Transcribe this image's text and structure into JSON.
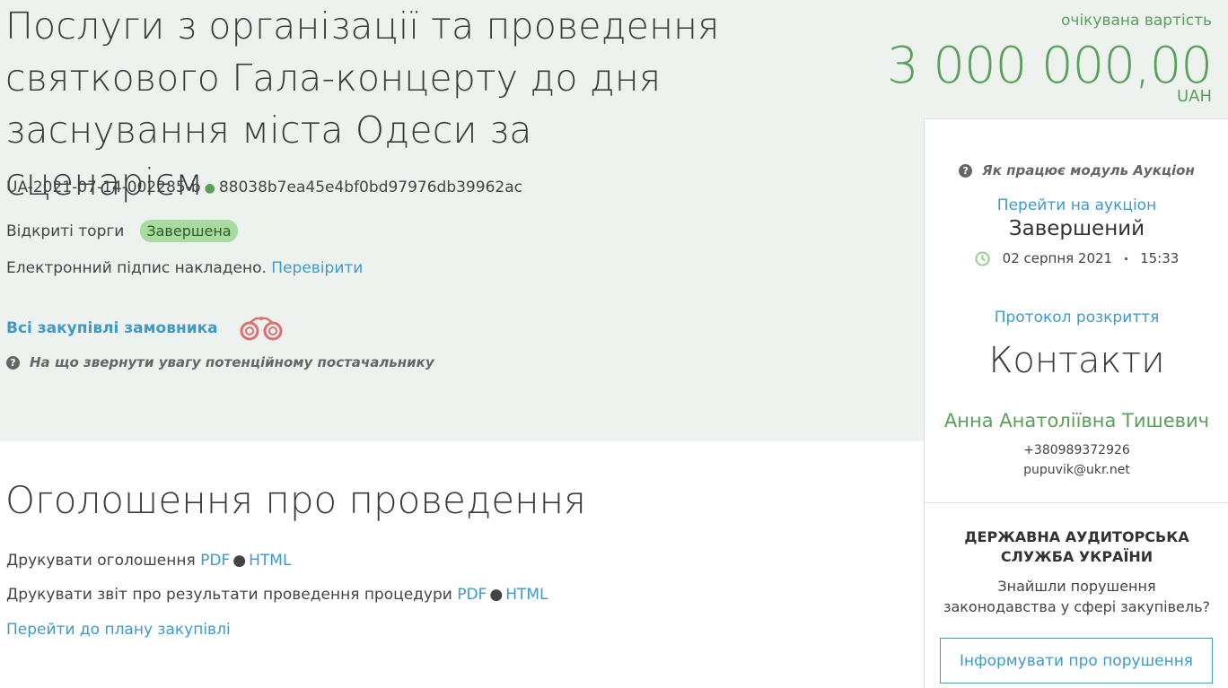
{
  "tender": {
    "title": "Послуги з організації та проведення святкового Гала-концерту до дня заснування міста Одеси за сценарієм",
    "id": "UA-2021-07-14-002285-b",
    "hash": "88038b7ea45e4bf0bd97976db39962ac",
    "procedure_type": "Відкриті торги",
    "status_badge": "Завершена",
    "signature_text": "Електронний підпис накладено.",
    "signature_link": "Перевірити",
    "all_purchases_link": "Всі закупівлі замовника",
    "supplier_help": "На що звернути увагу потенційному постачальнику"
  },
  "price": {
    "label": "очікувана вартість",
    "amount": "3 000 000,00",
    "currency": "UAH"
  },
  "sidebar": {
    "auction_help": "Як працює модуль Аукціон",
    "auction_link": "Перейти на аукціон",
    "auction_status": "Завершений",
    "auction_date": "02 серпня 2021",
    "auction_time": "15:33",
    "protocol_link": "Протокол розкриття",
    "contacts_title": "Контакти",
    "contact_name": "Анна Анатоліївна Тишевич",
    "contact_phone": "+380989372926",
    "contact_email": "pupuvik@ukr.net",
    "audit_title_line1": "ДЕРЖАВНА АУДИТОРСЬКА",
    "audit_title_line2": "СЛУЖБА УКРАЇНИ",
    "audit_text_line1": "Знайшли порушення",
    "audit_text_line2": "законодавства у сфері закупівель?",
    "report_button": "Інформувати про порушення"
  },
  "announcement": {
    "title": "Оголошення про проведення",
    "print_announcement": "Друкувати оголошення",
    "print_report": "Друкувати звіт про результати проведення процедури",
    "pdf": "PDF",
    "html": "HTML",
    "plan_link": "Перейти до плану закупівлі"
  },
  "colors": {
    "accent_green": "#5aa05a",
    "link_blue": "#3d9bcc",
    "badge_bg": "#a8dba0",
    "band_bg": "#eef2ef"
  },
  "icons": {
    "question": "question-circle-icon",
    "binoculars": "binoculars-icon",
    "clock": "clock-icon"
  }
}
